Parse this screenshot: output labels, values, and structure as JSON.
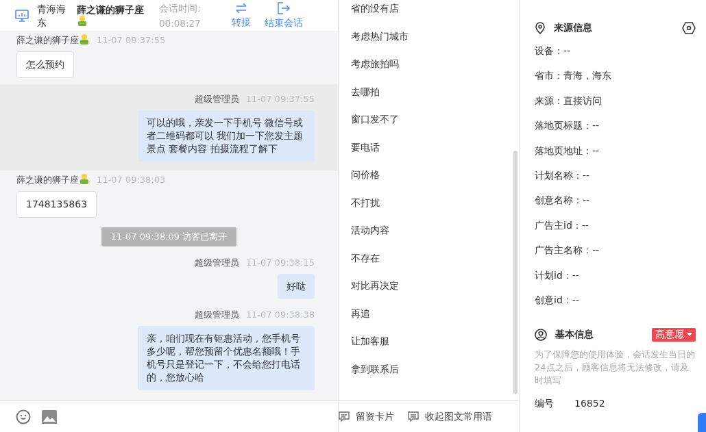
{
  "header": {
    "location": "青海海东",
    "visitor_name": "薛之谦的狮子座",
    "session_time_label": "会话时间:",
    "session_time": "00:08:27",
    "actions": [
      {
        "kind": "transfer",
        "label": "转接"
      },
      {
        "kind": "end",
        "label": "结束会话"
      }
    ]
  },
  "messages": [
    {
      "kind": "visitor",
      "sender": "薛之谦的狮子座",
      "time": "11-07 09:37:55",
      "text": "怎么预约",
      "highlighted": false
    },
    {
      "kind": "agent",
      "sender": "超级管理员",
      "time": "11-07 09:37:55",
      "text": "可以的哦，亲发一下手机号 微信号或者二维码都可以 我们加一下您发主题景点 套餐内容 拍摄流程了解下",
      "highlighted": true
    },
    {
      "kind": "visitor",
      "sender": "薛之谦的狮子座",
      "time": "11-07 09:38:03",
      "text": "1748135863",
      "highlighted": false
    },
    {
      "kind": "system",
      "text": "11-07 09:38:09 访客已离开"
    },
    {
      "kind": "agent",
      "sender": "超级管理员",
      "time": "11-07 09:38:15",
      "text": "好哒",
      "highlighted": false
    },
    {
      "kind": "agent",
      "sender": "超级管理员",
      "time": "11-07 09:38:38",
      "text": "亲，咱们现在有钜惠活动，您手机号多少呢，帮您预留个优惠名额哦！手机号只是登记一下，不会给您打电话的，您放心哈",
      "highlighted": false
    }
  ],
  "phrases": [
    "省的没有店",
    "考虑热门城市",
    "考虑旅拍吗",
    "去哪拍",
    "窗口发不了",
    "要电话",
    "问价格",
    "不打扰",
    "活动内容",
    "不存在",
    "对比再决定",
    "再追",
    "让加客服",
    "拿到联系后"
  ],
  "phrase_toolbar": [
    {
      "kind": "card",
      "label": "留资卡片"
    },
    {
      "kind": "collapse",
      "label": "收起图文常用语"
    }
  ],
  "source_info": {
    "title": "来源信息",
    "fields": [
      "设备：--",
      "省市：青海，海东",
      "来源：直接访问",
      "落地页标题：--",
      "落地页地址：--",
      "计划名称：--",
      "创意名称：--",
      "广告主id：--",
      "广告主名称：--",
      "计划id：--",
      "创意id：--"
    ]
  },
  "basic_info": {
    "title": "基本信息",
    "intent_tag": "高意愿",
    "note": "为了保障您的使用体验，会话发生当日的24点之后，顾客信息将无法修改，请及时填写",
    "fields": [
      {
        "label": "编号",
        "value": "16852"
      }
    ]
  }
}
